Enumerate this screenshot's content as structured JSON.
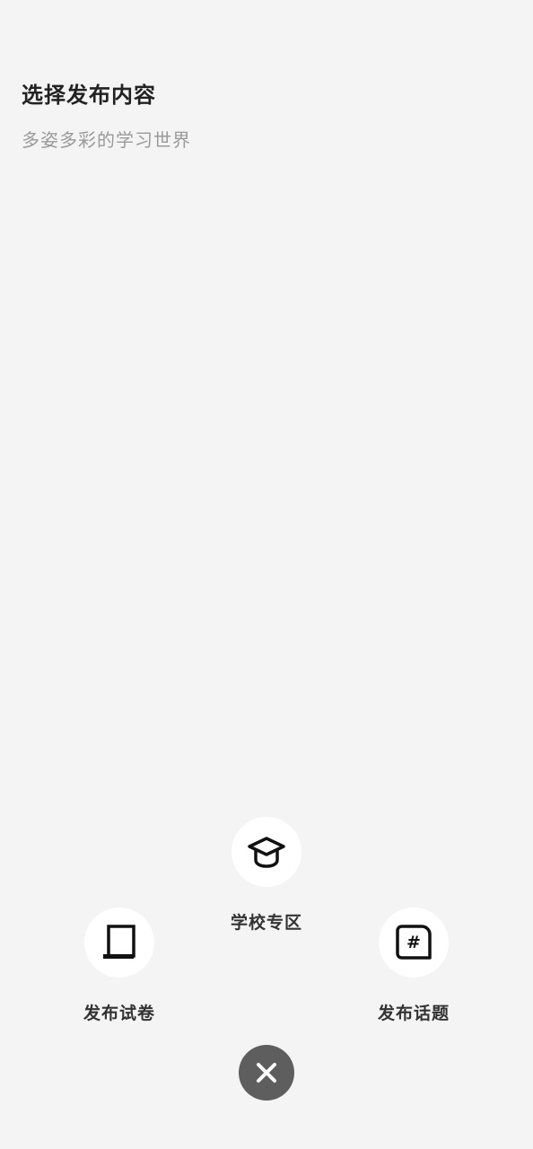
{
  "header": {
    "title": "选择发布内容",
    "subtitle": "多姿多彩的学习世界"
  },
  "menu": {
    "school": {
      "label": "学校专区",
      "icon": "graduation-cap-icon"
    },
    "exam": {
      "label": "发布试卷",
      "icon": "document-icon"
    },
    "topic": {
      "label": "发布话题",
      "icon": "hashtag-bubble-icon"
    }
  },
  "close": {
    "icon": "close-icon"
  },
  "colors": {
    "background": "#f4f4f4",
    "title": "#222222",
    "subtitle": "#9a9a9a",
    "circle": "#ffffff",
    "close_button": "#5e5e5e"
  }
}
